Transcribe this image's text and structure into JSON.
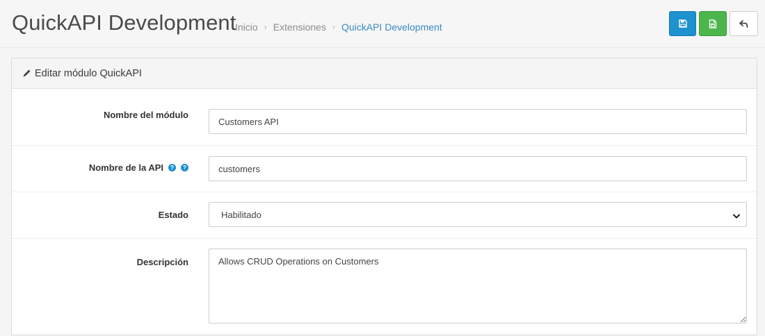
{
  "header": {
    "title": "QuickAPI Development",
    "breadcrumb": [
      {
        "label": "Inicio"
      },
      {
        "label": "Extensiones"
      },
      {
        "label": "QuickAPI Development"
      }
    ],
    "breadcrumb_separator": "›"
  },
  "toolbar": {
    "buttons": [
      {
        "icon": "save-icon",
        "color": "#1e91cf"
      },
      {
        "icon": "save-and-stay-icon",
        "color": "#4cb64c"
      },
      {
        "icon": "back-arrow-icon",
        "color": "#ffffff"
      }
    ]
  },
  "panel": {
    "icon": "pencil-icon",
    "heading": "Editar módulo QuickAPI"
  },
  "form": {
    "module_name": {
      "label": "Nombre del módulo",
      "value": "Customers API"
    },
    "api_name": {
      "label": "Nombre de la API",
      "value": "customers",
      "help_icons": [
        "?",
        "?"
      ]
    },
    "status": {
      "label": "Estado",
      "selected": "Habilitado"
    },
    "description": {
      "label": "Descripción",
      "value": "Allows CRUD Operations on Customers"
    }
  },
  "colors": {
    "accent": "#1e91cf",
    "success": "#4cb64c",
    "breadcrumb_active": "#3b8bc6"
  }
}
